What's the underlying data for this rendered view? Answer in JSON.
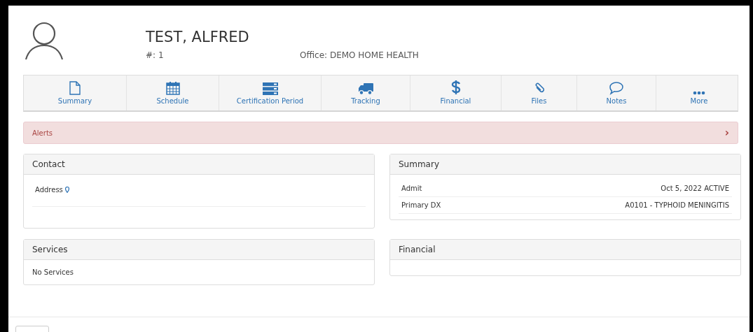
{
  "patient": {
    "name": "TEST, ALFRED",
    "number": "#: 1",
    "office": "Office: DEMO HOME HEALTH"
  },
  "nav": [
    {
      "kind": "document",
      "label": "Summary"
    },
    {
      "kind": "calendar",
      "label": "Schedule"
    },
    {
      "kind": "server",
      "label": "Certification Period"
    },
    {
      "kind": "truck",
      "label": "Tracking"
    },
    {
      "kind": "dollar",
      "label": "Financial"
    },
    {
      "kind": "paperclip",
      "label": "Files"
    },
    {
      "kind": "comment",
      "label": "Notes"
    },
    {
      "kind": "dots",
      "label": "More"
    }
  ],
  "alerts": {
    "label": "Alerts",
    "caret": "›"
  },
  "contact": {
    "title": "Contact",
    "address_label": "Address"
  },
  "summary": {
    "title": "Summary",
    "rows": [
      {
        "label": "Admit",
        "value": "Oct 5, 2022 ACTIVE"
      },
      {
        "label": "Primary DX",
        "value": "A0101 - TYPHOID MENINGITIS"
      }
    ]
  },
  "services": {
    "title": "Services",
    "empty": "No Services"
  },
  "financial": {
    "title": "Financial"
  }
}
